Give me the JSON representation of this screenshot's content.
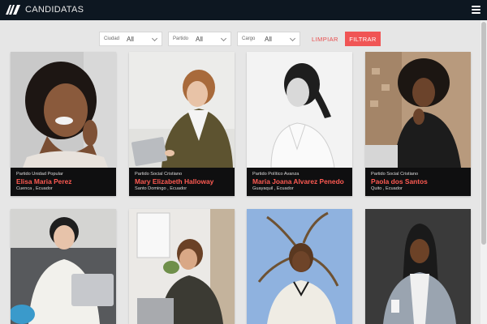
{
  "header": {
    "title": "CANDIDATAS",
    "logo_icon": "logo-icon",
    "menu_icon": "hamburger-menu-icon"
  },
  "filters": {
    "ciudad": {
      "label": "Ciudad",
      "value": "All"
    },
    "partido": {
      "label": "Partido",
      "value": "All"
    },
    "cargo": {
      "label": "Cargo",
      "value": "All"
    },
    "clear_label": "LIMPIAR",
    "filter_label": "FILTRAR"
  },
  "colors": {
    "topbar": "#0d1721",
    "accent": "#f05555",
    "name": "#ff5a52",
    "card_info": "#0f0f10",
    "background": "#e6e6e6"
  },
  "candidates": [
    {
      "party": "Partido Unidad Popular",
      "name": "Elisa Maria Perez",
      "place": "Cuenca , Ecuador"
    },
    {
      "party": "Partido Social Cristiano",
      "name": "Mary Elizabeth Halloway",
      "place": "Santo Domingo , Ecuador"
    },
    {
      "party": "Partido Político Avanza",
      "name": "Maria Joana Alvarez Penedo",
      "place": "Guayaquil , Ecuador"
    },
    {
      "party": "Partido Social Cristiano",
      "name": "Paola dos Santos",
      "place": "Quito , Ecuador"
    },
    {
      "party": "",
      "name": "",
      "place": ""
    },
    {
      "party": "",
      "name": "",
      "place": ""
    },
    {
      "party": "",
      "name": "",
      "place": ""
    },
    {
      "party": "",
      "name": "",
      "place": ""
    }
  ]
}
